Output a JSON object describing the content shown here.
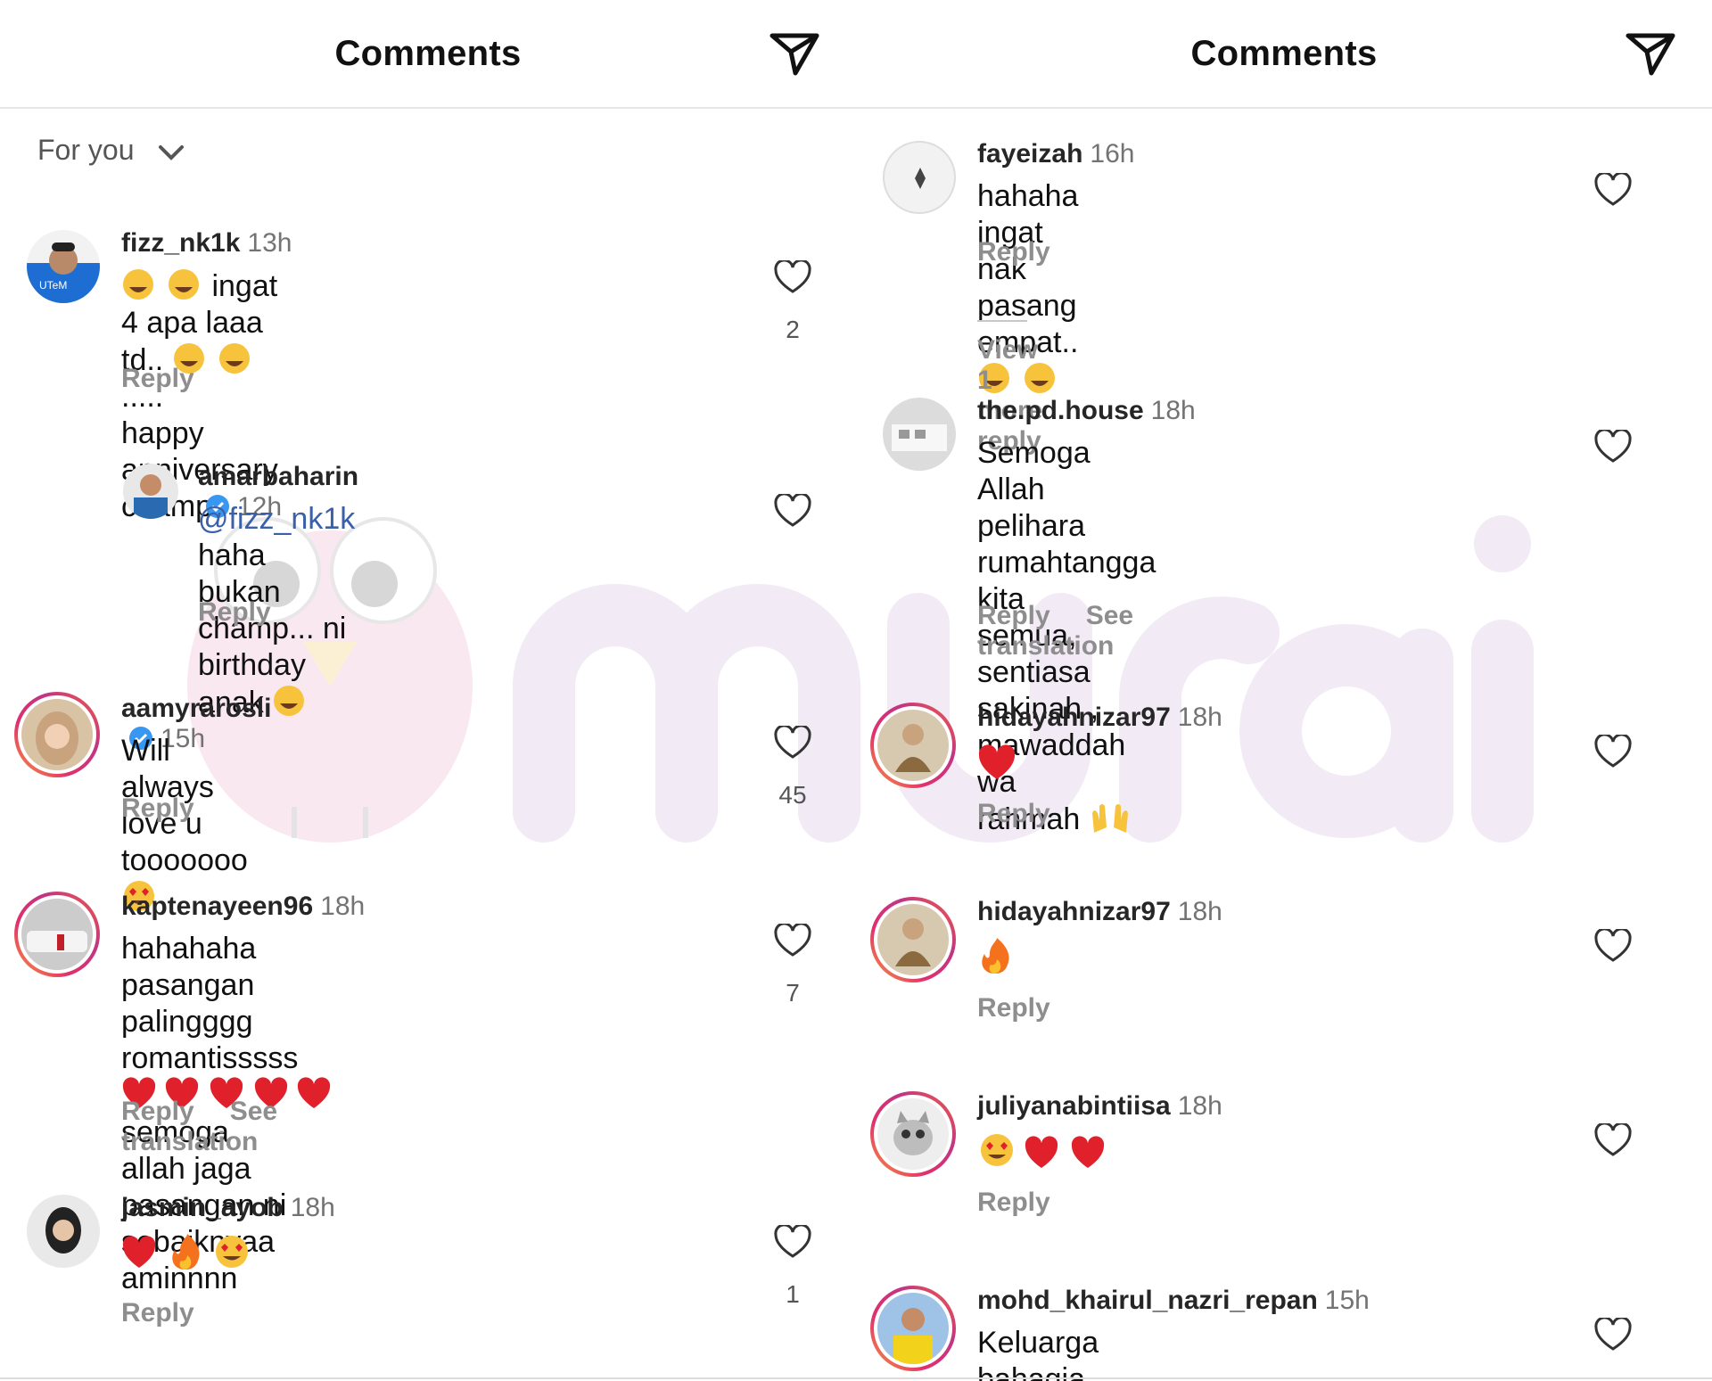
{
  "left": {
    "header": {
      "title": "Comments",
      "send_icon": "send-icon"
    },
    "sort": {
      "label": "For you"
    },
    "comments": [
      {
        "user": "fizz_nk1k",
        "time": "13h",
        "line1": "ingat 4 apa laaa td..",
        "line1_end": ".....",
        "line2": "happy anniversary champ",
        "reply": "Reply",
        "likes": "2"
      },
      {
        "user": "amarbaharin",
        "time": "12h",
        "mention": "@fizz_nk1k",
        "line1": " haha bukan champ... ni",
        "line2": "birthday anak",
        "reply": "Reply"
      },
      {
        "user": "aamyrarosli",
        "time": "15h",
        "line1": "Will always love u tooooooo",
        "reply": "Reply",
        "likes": "45"
      },
      {
        "user": "kaptenayeen96",
        "time": "18h",
        "line1": "hahahaha pasangan palingggg",
        "line2": "romantisssss",
        "line2_end": "semoga",
        "line3": "allah jaga pasangan ni sebaiknyaa",
        "line4": "aminnnn",
        "reply": "Reply",
        "translate": "See translation",
        "likes": "7"
      },
      {
        "user": "jasmin_ayob",
        "time": "18h",
        "reply": "Reply",
        "likes": "1"
      }
    ]
  },
  "right": {
    "header": {
      "title": "Comments"
    },
    "comments": [
      {
        "user": "fayeizah",
        "time": "16h",
        "line1": "hahaha ingat nak pasang empat..",
        "reply": "Reply",
        "view_more": "View 1 more reply"
      },
      {
        "user": "the.pd.house",
        "time": "18h",
        "line1": "Semoga Allah pelihara rumahtangga kita",
        "line2": "semua, sentiasa sakinah , mawaddah wa",
        "line3": "rahmah",
        "reply": "Reply",
        "translate": "See translation"
      },
      {
        "user": "hidayahnizar97",
        "time": "18h",
        "reply": "Reply"
      },
      {
        "user": "hidayahnizar97",
        "time": "18h",
        "reply": "Reply"
      },
      {
        "user": "juliyanabintiisa",
        "time": "18h",
        "reply": "Reply"
      },
      {
        "user": "mohd_khairul_nazri_repan",
        "time": "15h",
        "line1": "Keluarga bahagia"
      }
    ]
  },
  "colors": {
    "mention": "#3b5fa8",
    "verified": "#3897f0",
    "heart_red": "#e0202a",
    "ring_gradient": [
      "#f9a13a",
      "#e1306c",
      "#c13584"
    ]
  }
}
